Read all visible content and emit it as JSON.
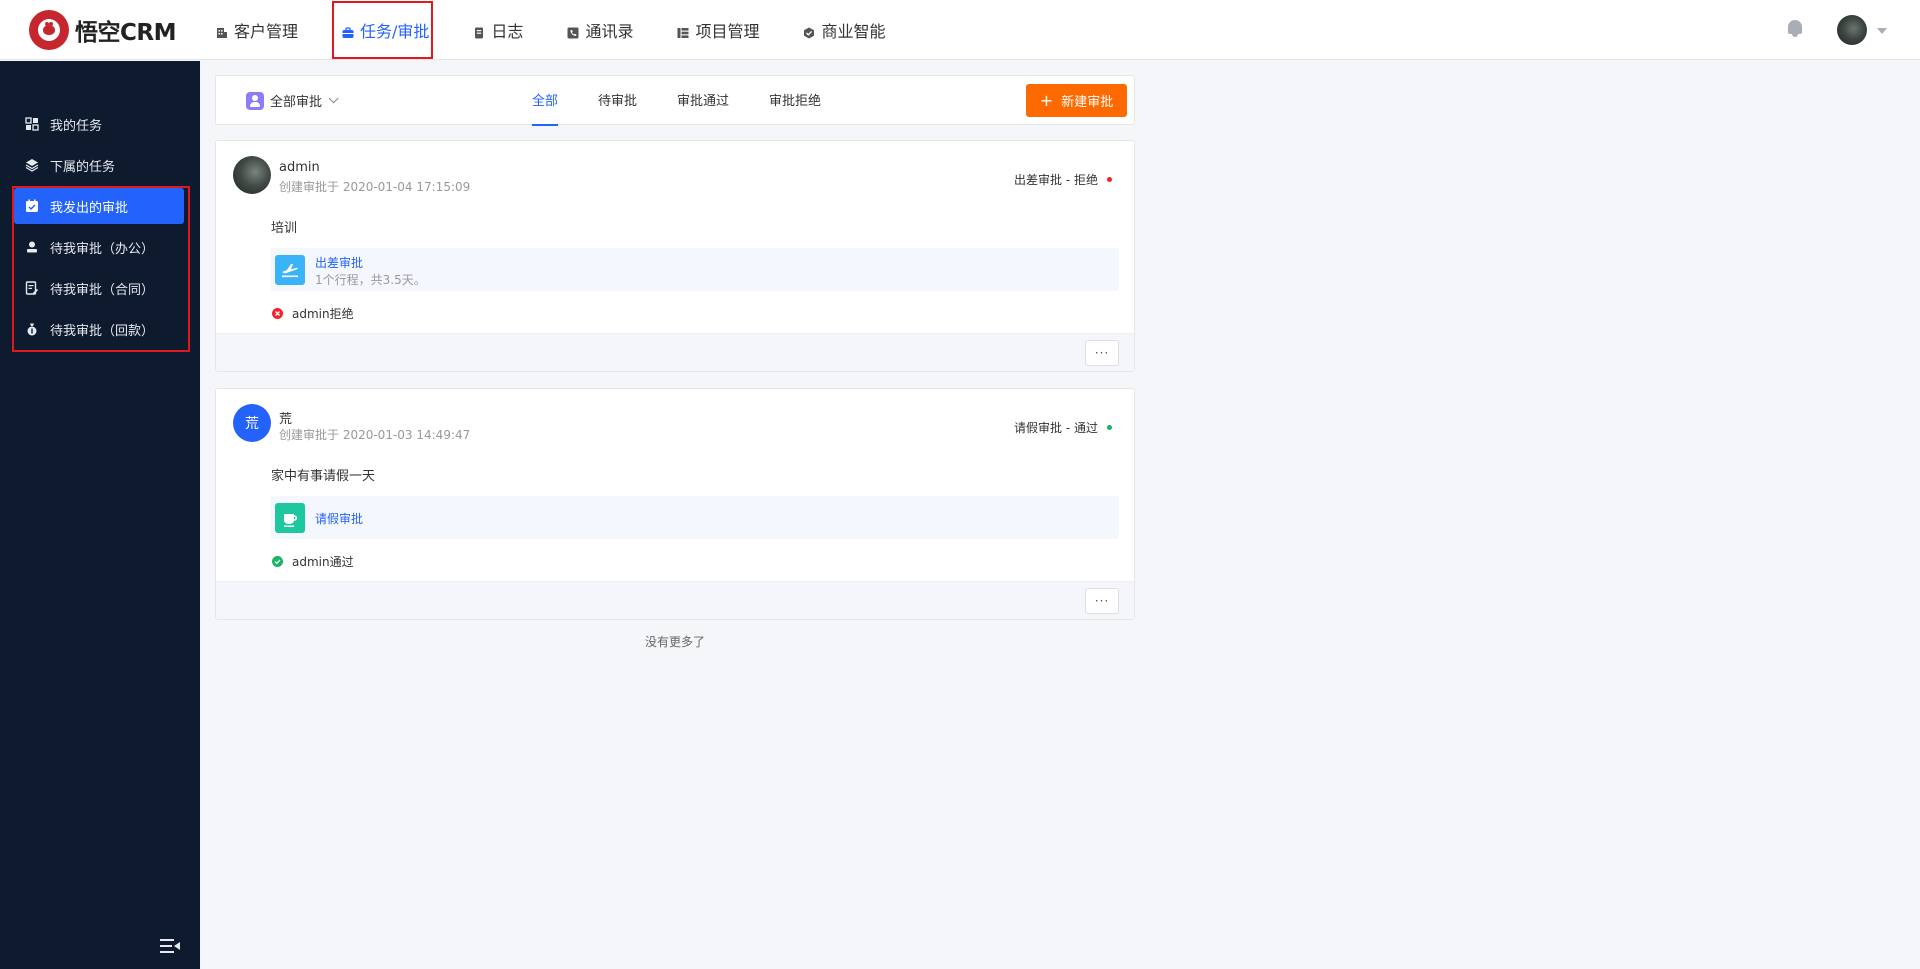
{
  "app": {
    "logo_text": "悟空CRM",
    "nav": [
      {
        "label": "客户管理",
        "icon": "building-icon"
      },
      {
        "label": "任务/审批",
        "icon": "briefcase-icon"
      },
      {
        "label": "日志",
        "icon": "journal-icon"
      },
      {
        "label": "通讯录",
        "icon": "contacts-icon"
      },
      {
        "label": "项目管理",
        "icon": "project-icon"
      },
      {
        "label": "商业智能",
        "icon": "bi-icon"
      }
    ],
    "active_nav": "任务/审批"
  },
  "sidebar": {
    "items": [
      {
        "label": "我的任务",
        "icon": "grid-icon"
      },
      {
        "label": "下属的任务",
        "icon": "layers-icon"
      },
      {
        "label": "我发出的审批",
        "icon": "calendar-check-icon"
      },
      {
        "label": "待我审批（办公）",
        "icon": "person-stamp-icon"
      },
      {
        "label": "待我审批（合同）",
        "icon": "contract-icon"
      },
      {
        "label": "待我审批（回款）",
        "icon": "money-bag-icon"
      }
    ],
    "active": "我发出的审批"
  },
  "filter": {
    "scope_label": "全部审批",
    "tabs": [
      "全部",
      "待审批",
      "审批通过",
      "审批拒绝"
    ],
    "active_tab": "全部",
    "new_button": "新建审批"
  },
  "approvals": [
    {
      "name": "admin",
      "avatar_letter": "",
      "created": "创建审批于 2020-01-04 17:15:09",
      "status": "出差审批 - 拒绝",
      "status_color": "#f5222d",
      "content": "培训",
      "related_title": "出差审批",
      "related_sub": "1个行程，共3.5天。",
      "related_icon": "airplane-icon",
      "related_color": "#3bb3f8",
      "result": "admin拒绝",
      "result_color": "#f5222d",
      "more": "···"
    },
    {
      "name": "荒",
      "avatar_letter": "荒",
      "created": "创建审批于 2020-01-03 14:49:47",
      "status": "请假审批 - 通过",
      "status_color": "#19b466",
      "content": "家中有事请假一天",
      "related_title": "请假审批",
      "related_sub": "",
      "related_icon": "coffee-cup-icon",
      "related_color": "#1ec7a0",
      "result": "admin通过",
      "result_color": "#19b466",
      "more": "···"
    }
  ],
  "footer": {
    "no_more": "没有更多了"
  },
  "colors": {
    "brand": "#2362fb",
    "accent_orange": "#ff6a00",
    "sidebar_bg": "#0e1a2e"
  }
}
